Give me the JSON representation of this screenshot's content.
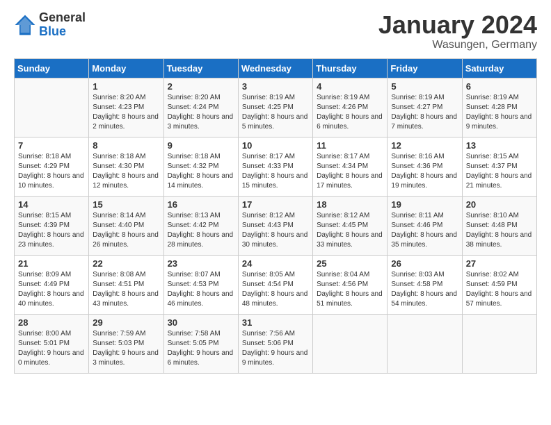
{
  "logo": {
    "general": "General",
    "blue": "Blue"
  },
  "header": {
    "month": "January 2024",
    "location": "Wasungen, Germany"
  },
  "weekdays": [
    "Sunday",
    "Monday",
    "Tuesday",
    "Wednesday",
    "Thursday",
    "Friday",
    "Saturday"
  ],
  "weeks": [
    [
      {
        "day": "",
        "sunrise": "",
        "sunset": "",
        "daylight": ""
      },
      {
        "day": "1",
        "sunrise": "Sunrise: 8:20 AM",
        "sunset": "Sunset: 4:23 PM",
        "daylight": "Daylight: 8 hours and 2 minutes."
      },
      {
        "day": "2",
        "sunrise": "Sunrise: 8:20 AM",
        "sunset": "Sunset: 4:24 PM",
        "daylight": "Daylight: 8 hours and 3 minutes."
      },
      {
        "day": "3",
        "sunrise": "Sunrise: 8:19 AM",
        "sunset": "Sunset: 4:25 PM",
        "daylight": "Daylight: 8 hours and 5 minutes."
      },
      {
        "day": "4",
        "sunrise": "Sunrise: 8:19 AM",
        "sunset": "Sunset: 4:26 PM",
        "daylight": "Daylight: 8 hours and 6 minutes."
      },
      {
        "day": "5",
        "sunrise": "Sunrise: 8:19 AM",
        "sunset": "Sunset: 4:27 PM",
        "daylight": "Daylight: 8 hours and 7 minutes."
      },
      {
        "day": "6",
        "sunrise": "Sunrise: 8:19 AM",
        "sunset": "Sunset: 4:28 PM",
        "daylight": "Daylight: 8 hours and 9 minutes."
      }
    ],
    [
      {
        "day": "7",
        "sunrise": "Sunrise: 8:18 AM",
        "sunset": "Sunset: 4:29 PM",
        "daylight": "Daylight: 8 hours and 10 minutes."
      },
      {
        "day": "8",
        "sunrise": "Sunrise: 8:18 AM",
        "sunset": "Sunset: 4:30 PM",
        "daylight": "Daylight: 8 hours and 12 minutes."
      },
      {
        "day": "9",
        "sunrise": "Sunrise: 8:18 AM",
        "sunset": "Sunset: 4:32 PM",
        "daylight": "Daylight: 8 hours and 14 minutes."
      },
      {
        "day": "10",
        "sunrise": "Sunrise: 8:17 AM",
        "sunset": "Sunset: 4:33 PM",
        "daylight": "Daylight: 8 hours and 15 minutes."
      },
      {
        "day": "11",
        "sunrise": "Sunrise: 8:17 AM",
        "sunset": "Sunset: 4:34 PM",
        "daylight": "Daylight: 8 hours and 17 minutes."
      },
      {
        "day": "12",
        "sunrise": "Sunrise: 8:16 AM",
        "sunset": "Sunset: 4:36 PM",
        "daylight": "Daylight: 8 hours and 19 minutes."
      },
      {
        "day": "13",
        "sunrise": "Sunrise: 8:15 AM",
        "sunset": "Sunset: 4:37 PM",
        "daylight": "Daylight: 8 hours and 21 minutes."
      }
    ],
    [
      {
        "day": "14",
        "sunrise": "Sunrise: 8:15 AM",
        "sunset": "Sunset: 4:39 PM",
        "daylight": "Daylight: 8 hours and 23 minutes."
      },
      {
        "day": "15",
        "sunrise": "Sunrise: 8:14 AM",
        "sunset": "Sunset: 4:40 PM",
        "daylight": "Daylight: 8 hours and 26 minutes."
      },
      {
        "day": "16",
        "sunrise": "Sunrise: 8:13 AM",
        "sunset": "Sunset: 4:42 PM",
        "daylight": "Daylight: 8 hours and 28 minutes."
      },
      {
        "day": "17",
        "sunrise": "Sunrise: 8:12 AM",
        "sunset": "Sunset: 4:43 PM",
        "daylight": "Daylight: 8 hours and 30 minutes."
      },
      {
        "day": "18",
        "sunrise": "Sunrise: 8:12 AM",
        "sunset": "Sunset: 4:45 PM",
        "daylight": "Daylight: 8 hours and 33 minutes."
      },
      {
        "day": "19",
        "sunrise": "Sunrise: 8:11 AM",
        "sunset": "Sunset: 4:46 PM",
        "daylight": "Daylight: 8 hours and 35 minutes."
      },
      {
        "day": "20",
        "sunrise": "Sunrise: 8:10 AM",
        "sunset": "Sunset: 4:48 PM",
        "daylight": "Daylight: 8 hours and 38 minutes."
      }
    ],
    [
      {
        "day": "21",
        "sunrise": "Sunrise: 8:09 AM",
        "sunset": "Sunset: 4:49 PM",
        "daylight": "Daylight: 8 hours and 40 minutes."
      },
      {
        "day": "22",
        "sunrise": "Sunrise: 8:08 AM",
        "sunset": "Sunset: 4:51 PM",
        "daylight": "Daylight: 8 hours and 43 minutes."
      },
      {
        "day": "23",
        "sunrise": "Sunrise: 8:07 AM",
        "sunset": "Sunset: 4:53 PM",
        "daylight": "Daylight: 8 hours and 46 minutes."
      },
      {
        "day": "24",
        "sunrise": "Sunrise: 8:05 AM",
        "sunset": "Sunset: 4:54 PM",
        "daylight": "Daylight: 8 hours and 48 minutes."
      },
      {
        "day": "25",
        "sunrise": "Sunrise: 8:04 AM",
        "sunset": "Sunset: 4:56 PM",
        "daylight": "Daylight: 8 hours and 51 minutes."
      },
      {
        "day": "26",
        "sunrise": "Sunrise: 8:03 AM",
        "sunset": "Sunset: 4:58 PM",
        "daylight": "Daylight: 8 hours and 54 minutes."
      },
      {
        "day": "27",
        "sunrise": "Sunrise: 8:02 AM",
        "sunset": "Sunset: 4:59 PM",
        "daylight": "Daylight: 8 hours and 57 minutes."
      }
    ],
    [
      {
        "day": "28",
        "sunrise": "Sunrise: 8:00 AM",
        "sunset": "Sunset: 5:01 PM",
        "daylight": "Daylight: 9 hours and 0 minutes."
      },
      {
        "day": "29",
        "sunrise": "Sunrise: 7:59 AM",
        "sunset": "Sunset: 5:03 PM",
        "daylight": "Daylight: 9 hours and 3 minutes."
      },
      {
        "day": "30",
        "sunrise": "Sunrise: 7:58 AM",
        "sunset": "Sunset: 5:05 PM",
        "daylight": "Daylight: 9 hours and 6 minutes."
      },
      {
        "day": "31",
        "sunrise": "Sunrise: 7:56 AM",
        "sunset": "Sunset: 5:06 PM",
        "daylight": "Daylight: 9 hours and 9 minutes."
      },
      {
        "day": "",
        "sunrise": "",
        "sunset": "",
        "daylight": ""
      },
      {
        "day": "",
        "sunrise": "",
        "sunset": "",
        "daylight": ""
      },
      {
        "day": "",
        "sunrise": "",
        "sunset": "",
        "daylight": ""
      }
    ]
  ]
}
